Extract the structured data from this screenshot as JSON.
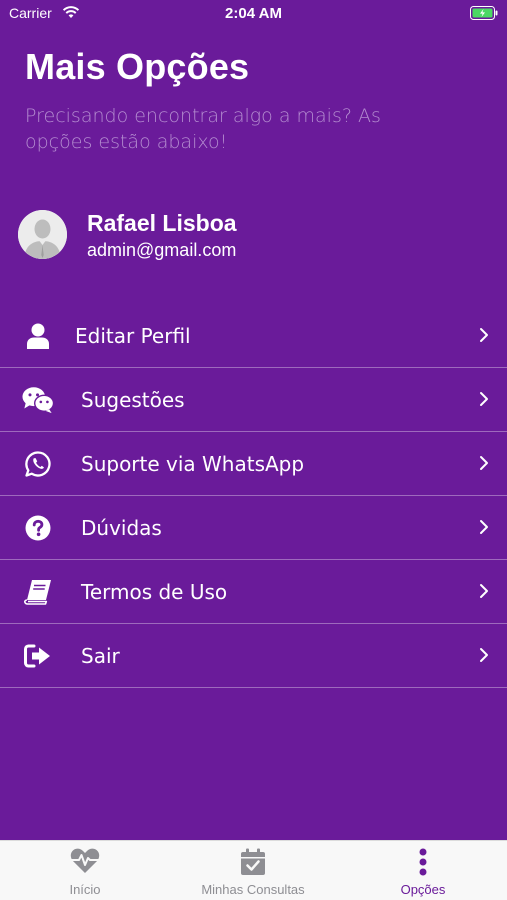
{
  "status_bar": {
    "carrier": "Carrier",
    "time": "2:04 AM"
  },
  "header": {
    "title": "Mais Opções",
    "subtitle": "Precisando encontrar algo a mais? As opções estão abaixo!"
  },
  "profile": {
    "name": "Rafael Lisboa",
    "email": "admin@gmail.com"
  },
  "menu": {
    "items": [
      {
        "label": "Editar Perfil",
        "icon": "user-icon"
      },
      {
        "label": "Sugestões",
        "icon": "chat-icon"
      },
      {
        "label": "Suporte via WhatsApp",
        "icon": "whatsapp-icon"
      },
      {
        "label": "Dúvidas",
        "icon": "question-icon"
      },
      {
        "label": "Termos de Uso",
        "icon": "book-icon"
      },
      {
        "label": "Sair",
        "icon": "sign-out-icon"
      }
    ]
  },
  "tab_bar": {
    "tabs": [
      {
        "label": "Início",
        "icon": "heartbeat-icon"
      },
      {
        "label": "Minhas Consultas",
        "icon": "calendar-check-icon"
      },
      {
        "label": "Opções",
        "icon": "vertical-dots-icon",
        "active": true
      }
    ]
  },
  "colors": {
    "primary": "#6a1b9a",
    "subtitle": "#b48cd0",
    "tab_inactive": "#8e8e93",
    "tab_bar_bg": "#f8f8f8"
  }
}
